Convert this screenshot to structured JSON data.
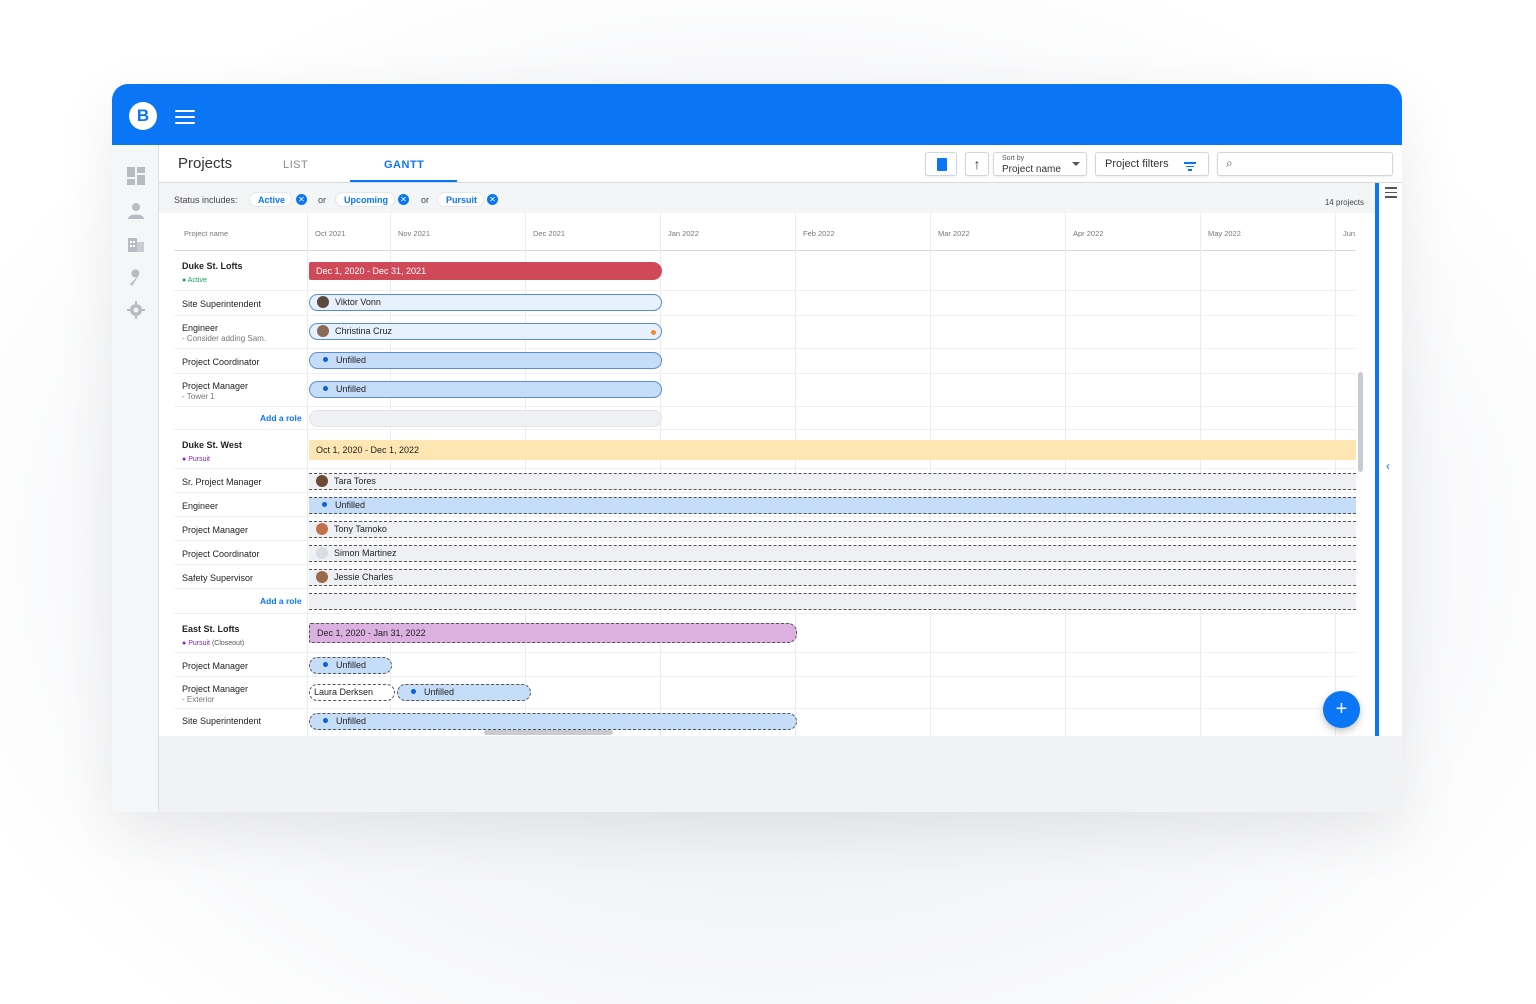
{
  "app": {
    "logo_letter": "B",
    "brand_color": "#0a76f6"
  },
  "header": {
    "title": "Projects",
    "tabs": [
      {
        "label": "LIST",
        "active": false
      },
      {
        "label": "GANTT",
        "active": true
      }
    ],
    "sort_caption": "Sort by",
    "sort_value": "Project name",
    "filters_label": "Project filters",
    "search_placeholder": ""
  },
  "status": {
    "label": "Status includes:",
    "chips": [
      "Active",
      "Upcoming",
      "Pursuit"
    ],
    "connector": "or",
    "count": "14 projects"
  },
  "columns": {
    "name_header": "Project name",
    "months": [
      "Oct 2021",
      "Nov 2021",
      "Dec 2021",
      "Jan 2022",
      "Feb 2022",
      "Mar 2022",
      "Apr 2022",
      "May 2022",
      "Jun"
    ]
  },
  "projects": [
    {
      "name": "Duke St. Lofts",
      "status": "Active",
      "status_color": "#1aa35a",
      "bar_label": "Dec 1, 2020 - Dec 31, 2021",
      "bar_color": "#d04959",
      "roles": [
        {
          "role": "Site Superintendent",
          "note": "",
          "assignee": "Viktor Vonn"
        },
        {
          "role": "Engineer",
          "note": "- Consider adding Sam.",
          "assignee": "Christina Cruz"
        },
        {
          "role": "Project Coordinator",
          "note": "",
          "assignee": "Unfilled"
        },
        {
          "role": "Project Manager",
          "note": "- Tower 1",
          "assignee": "Unfilled"
        }
      ],
      "add_role": "Add a role"
    },
    {
      "name": "Duke St. West",
      "status": "Pursuit",
      "status_color": "#8a1fc2",
      "bar_label": "Oct 1, 2020 - Dec 1, 2022",
      "bar_color": "#fde6b1",
      "roles": [
        {
          "role": "Sr. Project Manager",
          "note": "",
          "assignee": "Tara Tores"
        },
        {
          "role": "Engineer",
          "note": "",
          "assignee": "Unfilled"
        },
        {
          "role": "Project Manager",
          "note": "",
          "assignee": "Tony Tamoko"
        },
        {
          "role": "Project Coordinator",
          "note": "",
          "assignee": "Simon Martinez"
        },
        {
          "role": "Safety Supervisor",
          "note": "",
          "assignee": "Jessie Charles"
        }
      ],
      "add_role": "Add a role"
    },
    {
      "name": "East St. Lofts",
      "status": "Pursuit",
      "status_suffix": "(Closeout)",
      "status_color": "#8a1fc2",
      "bar_label": "Dec 1, 2020 - Jan 31, 2022",
      "bar_color": "#dcb1e1",
      "roles": [
        {
          "role": "Project Manager",
          "note": "",
          "assignee": "Unfilled"
        },
        {
          "role": "Project Manager",
          "note": "- Exterior",
          "assignee": "Laura Derksen",
          "assignee2": "Unfilled"
        },
        {
          "role": "Site Superintendent",
          "note": "",
          "assignee": "Unfilled"
        }
      ]
    }
  ],
  "fab_label": "+"
}
